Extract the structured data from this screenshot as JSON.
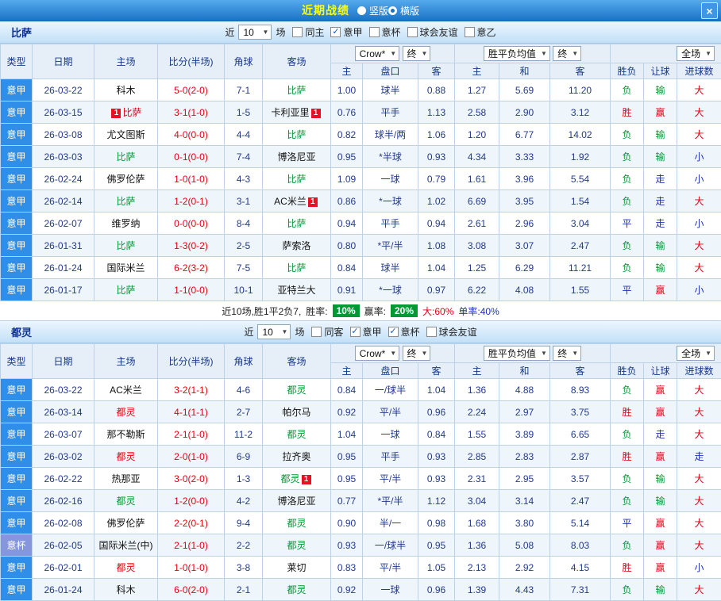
{
  "titlebar": {
    "title": "近期战绩",
    "radios": [
      {
        "label": "竖版",
        "selected": false
      },
      {
        "label": "横版",
        "selected": true
      }
    ],
    "close_label": "×"
  },
  "filter_labels": {
    "near": "近",
    "games": "场"
  },
  "table_headers": {
    "type": "类型",
    "date": "日期",
    "home": "主场",
    "score": "比分(半场)",
    "corner": "角球",
    "away": "客场",
    "bookmaker": "Crow*",
    "final": "终",
    "odds_home": "主",
    "handicap": "盘口",
    "odds_away": "客",
    "avg_label": "胜平负均值",
    "avg_home": "主",
    "avg_draw": "和",
    "avg_away": "客",
    "result": "胜负",
    "give": "让球",
    "goals": "进球数",
    "scope": "全场"
  },
  "colors": {
    "win_red": "#e60012",
    "loss_green": "#009933",
    "draw_blue": "#1f2fc0",
    "odds_navy": "#233a8c",
    "serie_a_blue": "#2f8fe8",
    "cup_blue": "#8696dd",
    "rate_badge_green": "#009933",
    "red_card_badge": "#e81123"
  },
  "sections": [
    {
      "team": "比萨",
      "filter": {
        "count": "10",
        "checkboxes": [
          {
            "label": "同主",
            "checked": false
          },
          {
            "label": "意甲",
            "checked": true
          },
          {
            "label": "意杯",
            "checked": false
          },
          {
            "label": "球会友谊",
            "checked": false
          },
          {
            "label": "意乙",
            "checked": false
          }
        ]
      },
      "rows": [
        {
          "type": "意甲",
          "date": "26-03-22",
          "home": "科木",
          "home_color": "black",
          "score": "5-0(2-0)",
          "corner": "7-1",
          "away": "比萨",
          "away_color": "green",
          "odds": [
            "1.00",
            "球半",
            "0.88"
          ],
          "avg": [
            "1.27",
            "5.69",
            "11.20"
          ],
          "result": "负",
          "result_color": "green",
          "give": "输",
          "give_color": "green",
          "goals": "大",
          "goals_color": "red"
        },
        {
          "type": "意甲",
          "date": "26-03-15",
          "home": "比萨",
          "home_color": "red",
          "home_badge_pre": "1",
          "score": "3-1(1-0)",
          "corner": "1-5",
          "away": "卡利亚里",
          "away_color": "black",
          "away_badge_post": "1",
          "odds": [
            "0.76",
            "平手",
            "1.13"
          ],
          "avg": [
            "2.58",
            "2.90",
            "3.12"
          ],
          "result": "胜",
          "result_color": "red",
          "give": "赢",
          "give_color": "red",
          "goals": "大",
          "goals_color": "red"
        },
        {
          "type": "意甲",
          "date": "26-03-08",
          "home": "尤文图斯",
          "home_color": "black",
          "score": "4-0(0-0)",
          "corner": "4-4",
          "away": "比萨",
          "away_color": "green",
          "odds": [
            "0.82",
            "球半/两",
            "1.06"
          ],
          "avg": [
            "1.20",
            "6.77",
            "14.02"
          ],
          "result": "负",
          "result_color": "green",
          "give": "输",
          "give_color": "green",
          "goals": "大",
          "goals_color": "red"
        },
        {
          "type": "意甲",
          "date": "26-03-03",
          "home": "比萨",
          "home_color": "green",
          "score": "0-1(0-0)",
          "corner": "7-4",
          "away": "博洛尼亚",
          "away_color": "black",
          "odds": [
            "0.95",
            "*半球",
            "0.93"
          ],
          "avg": [
            "4.34",
            "3.33",
            "1.92"
          ],
          "result": "负",
          "result_color": "green",
          "give": "输",
          "give_color": "green",
          "goals": "小",
          "goals_color": "blue"
        },
        {
          "type": "意甲",
          "date": "26-02-24",
          "home": "佛罗伦萨",
          "home_color": "black",
          "score": "1-0(1-0)",
          "corner": "4-3",
          "away": "比萨",
          "away_color": "green",
          "odds": [
            "1.09",
            "一球",
            "0.79"
          ],
          "avg": [
            "1.61",
            "3.96",
            "5.54"
          ],
          "result": "负",
          "result_color": "green",
          "give": "走",
          "give_color": "blue",
          "goals": "小",
          "goals_color": "blue"
        },
        {
          "type": "意甲",
          "date": "26-02-14",
          "home": "比萨",
          "home_color": "green",
          "score": "1-2(0-1)",
          "corner": "3-1",
          "away": "AC米兰",
          "away_color": "black",
          "away_badge_post": "1",
          "odds": [
            "0.86",
            "*一球",
            "1.02"
          ],
          "avg": [
            "6.69",
            "3.95",
            "1.54"
          ],
          "result": "负",
          "result_color": "green",
          "give": "走",
          "give_color": "blue",
          "goals": "大",
          "goals_color": "red"
        },
        {
          "type": "意甲",
          "date": "26-02-07",
          "home": "维罗纳",
          "home_color": "black",
          "score": "0-0(0-0)",
          "corner": "8-4",
          "away": "比萨",
          "away_color": "green",
          "odds": [
            "0.94",
            "平手",
            "0.94"
          ],
          "avg": [
            "2.61",
            "2.96",
            "3.04"
          ],
          "result": "平",
          "result_color": "blue",
          "give": "走",
          "give_color": "blue",
          "goals": "小",
          "goals_color": "blue"
        },
        {
          "type": "意甲",
          "date": "26-01-31",
          "home": "比萨",
          "home_color": "green",
          "score": "1-3(0-2)",
          "corner": "2-5",
          "away": "萨索洛",
          "away_color": "black",
          "odds": [
            "0.80",
            "*平/半",
            "1.08"
          ],
          "avg": [
            "3.08",
            "3.07",
            "2.47"
          ],
          "result": "负",
          "result_color": "green",
          "give": "输",
          "give_color": "green",
          "goals": "大",
          "goals_color": "red"
        },
        {
          "type": "意甲",
          "date": "26-01-24",
          "home": "国际米兰",
          "home_color": "black",
          "score": "6-2(3-2)",
          "corner": "7-5",
          "away": "比萨",
          "away_color": "green",
          "odds": [
            "0.84",
            "球半",
            "1.04"
          ],
          "avg": [
            "1.25",
            "6.29",
            "11.21"
          ],
          "result": "负",
          "result_color": "green",
          "give": "输",
          "give_color": "green",
          "goals": "大",
          "goals_color": "red"
        },
        {
          "type": "意甲",
          "date": "26-01-17",
          "home": "比萨",
          "home_color": "green",
          "score": "1-1(0-0)",
          "corner": "10-1",
          "away": "亚特兰大",
          "away_color": "black",
          "odds": [
            "0.91",
            "*一球",
            "0.97"
          ],
          "avg": [
            "6.22",
            "4.08",
            "1.55"
          ],
          "result": "平",
          "result_color": "blue",
          "give": "赢",
          "give_color": "red",
          "goals": "小",
          "goals_color": "blue"
        }
      ],
      "summary": {
        "prefix": "近10场,胜1平2负7,",
        "win_rate_label": "胜率:",
        "win_rate": "10%",
        "profit_rate_label": "赢率:",
        "profit_rate": "20%",
        "big_text": "大:60%",
        "odd_text": "单率:40%"
      }
    },
    {
      "team": "都灵",
      "filter": {
        "count": "10",
        "checkboxes": [
          {
            "label": "同客",
            "checked": false
          },
          {
            "label": "意甲",
            "checked": true
          },
          {
            "label": "意杯",
            "checked": true
          },
          {
            "label": "球会友谊",
            "checked": false
          }
        ]
      },
      "rows": [
        {
          "type": "意甲",
          "date": "26-03-22",
          "home": "AC米兰",
          "home_color": "black",
          "score": "3-2(1-1)",
          "corner": "4-6",
          "away": "都灵",
          "away_color": "green",
          "odds": [
            "0.84",
            "一/球半",
            "1.04"
          ],
          "avg": [
            "1.36",
            "4.88",
            "8.93"
          ],
          "result": "负",
          "result_color": "green",
          "give": "赢",
          "give_color": "red",
          "goals": "大",
          "goals_color": "red"
        },
        {
          "type": "意甲",
          "date": "26-03-14",
          "home": "都灵",
          "home_color": "red",
          "score": "4-1(1-1)",
          "corner": "2-7",
          "away": "帕尔马",
          "away_color": "black",
          "odds": [
            "0.92",
            "平/半",
            "0.96"
          ],
          "avg": [
            "2.24",
            "2.97",
            "3.75"
          ],
          "result": "胜",
          "result_color": "red",
          "give": "赢",
          "give_color": "red",
          "goals": "大",
          "goals_color": "red"
        },
        {
          "type": "意甲",
          "date": "26-03-07",
          "home": "那不勒斯",
          "home_color": "black",
          "score": "2-1(1-0)",
          "corner": "11-2",
          "away": "都灵",
          "away_color": "green",
          "odds": [
            "1.04",
            "一球",
            "0.84"
          ],
          "avg": [
            "1.55",
            "3.89",
            "6.65"
          ],
          "result": "负",
          "result_color": "green",
          "give": "走",
          "give_color": "blue",
          "goals": "大",
          "goals_color": "red"
        },
        {
          "type": "意甲",
          "date": "26-03-02",
          "home": "都灵",
          "home_color": "red",
          "score": "2-0(1-0)",
          "corner": "6-9",
          "away": "拉齐奥",
          "away_color": "black",
          "odds": [
            "0.95",
            "平手",
            "0.93"
          ],
          "avg": [
            "2.85",
            "2.83",
            "2.87"
          ],
          "result": "胜",
          "result_color": "red",
          "give": "赢",
          "give_color": "red",
          "goals": "走",
          "goals_color": "blue"
        },
        {
          "type": "意甲",
          "date": "26-02-22",
          "home": "热那亚",
          "home_color": "black",
          "score": "3-0(2-0)",
          "corner": "1-3",
          "away": "都灵",
          "away_color": "green",
          "away_badge_post": "1",
          "odds": [
            "0.95",
            "平/半",
            "0.93"
          ],
          "avg": [
            "2.31",
            "2.95",
            "3.57"
          ],
          "result": "负",
          "result_color": "green",
          "give": "输",
          "give_color": "green",
          "goals": "大",
          "goals_color": "red"
        },
        {
          "type": "意甲",
          "date": "26-02-16",
          "home": "都灵",
          "home_color": "green",
          "score": "1-2(0-0)",
          "corner": "4-2",
          "away": "博洛尼亚",
          "away_color": "black",
          "odds": [
            "0.77",
            "*平/半",
            "1.12"
          ],
          "avg": [
            "3.04",
            "3.14",
            "2.47"
          ],
          "result": "负",
          "result_color": "green",
          "give": "输",
          "give_color": "green",
          "goals": "大",
          "goals_color": "red"
        },
        {
          "type": "意甲",
          "date": "26-02-08",
          "home": "佛罗伦萨",
          "home_color": "black",
          "score": "2-2(0-1)",
          "corner": "9-4",
          "away": "都灵",
          "away_color": "green",
          "odds": [
            "0.90",
            "半/一",
            "0.98"
          ],
          "avg": [
            "1.68",
            "3.80",
            "5.14"
          ],
          "result": "平",
          "result_color": "blue",
          "give": "赢",
          "give_color": "red",
          "goals": "大",
          "goals_color": "red"
        },
        {
          "type": "意杯",
          "type_style": "cup",
          "date": "26-02-05",
          "home": "国际米兰(中)",
          "home_color": "black",
          "score": "2-1(1-0)",
          "corner": "2-2",
          "away": "都灵",
          "away_color": "green",
          "odds": [
            "0.93",
            "一/球半",
            "0.95"
          ],
          "avg": [
            "1.36",
            "5.08",
            "8.03"
          ],
          "result": "负",
          "result_color": "green",
          "give": "赢",
          "give_color": "red",
          "goals": "大",
          "goals_color": "red"
        },
        {
          "type": "意甲",
          "date": "26-02-01",
          "home": "都灵",
          "home_color": "red",
          "score": "1-0(1-0)",
          "corner": "3-8",
          "away": "莱切",
          "away_color": "black",
          "odds": [
            "0.83",
            "平/半",
            "1.05"
          ],
          "avg": [
            "2.13",
            "2.92",
            "4.15"
          ],
          "result": "胜",
          "result_color": "red",
          "give": "赢",
          "give_color": "red",
          "goals": "小",
          "goals_color": "blue"
        },
        {
          "type": "意甲",
          "date": "26-01-24",
          "home": "科木",
          "home_color": "black",
          "score": "6-0(2-0)",
          "corner": "2-1",
          "away": "都灵",
          "away_color": "green",
          "odds": [
            "0.92",
            "一球",
            "0.96"
          ],
          "avg": [
            "1.39",
            "4.43",
            "7.31"
          ],
          "result": "负",
          "result_color": "green",
          "give": "输",
          "give_color": "green",
          "goals": "大",
          "goals_color": "red"
        }
      ]
    }
  ]
}
